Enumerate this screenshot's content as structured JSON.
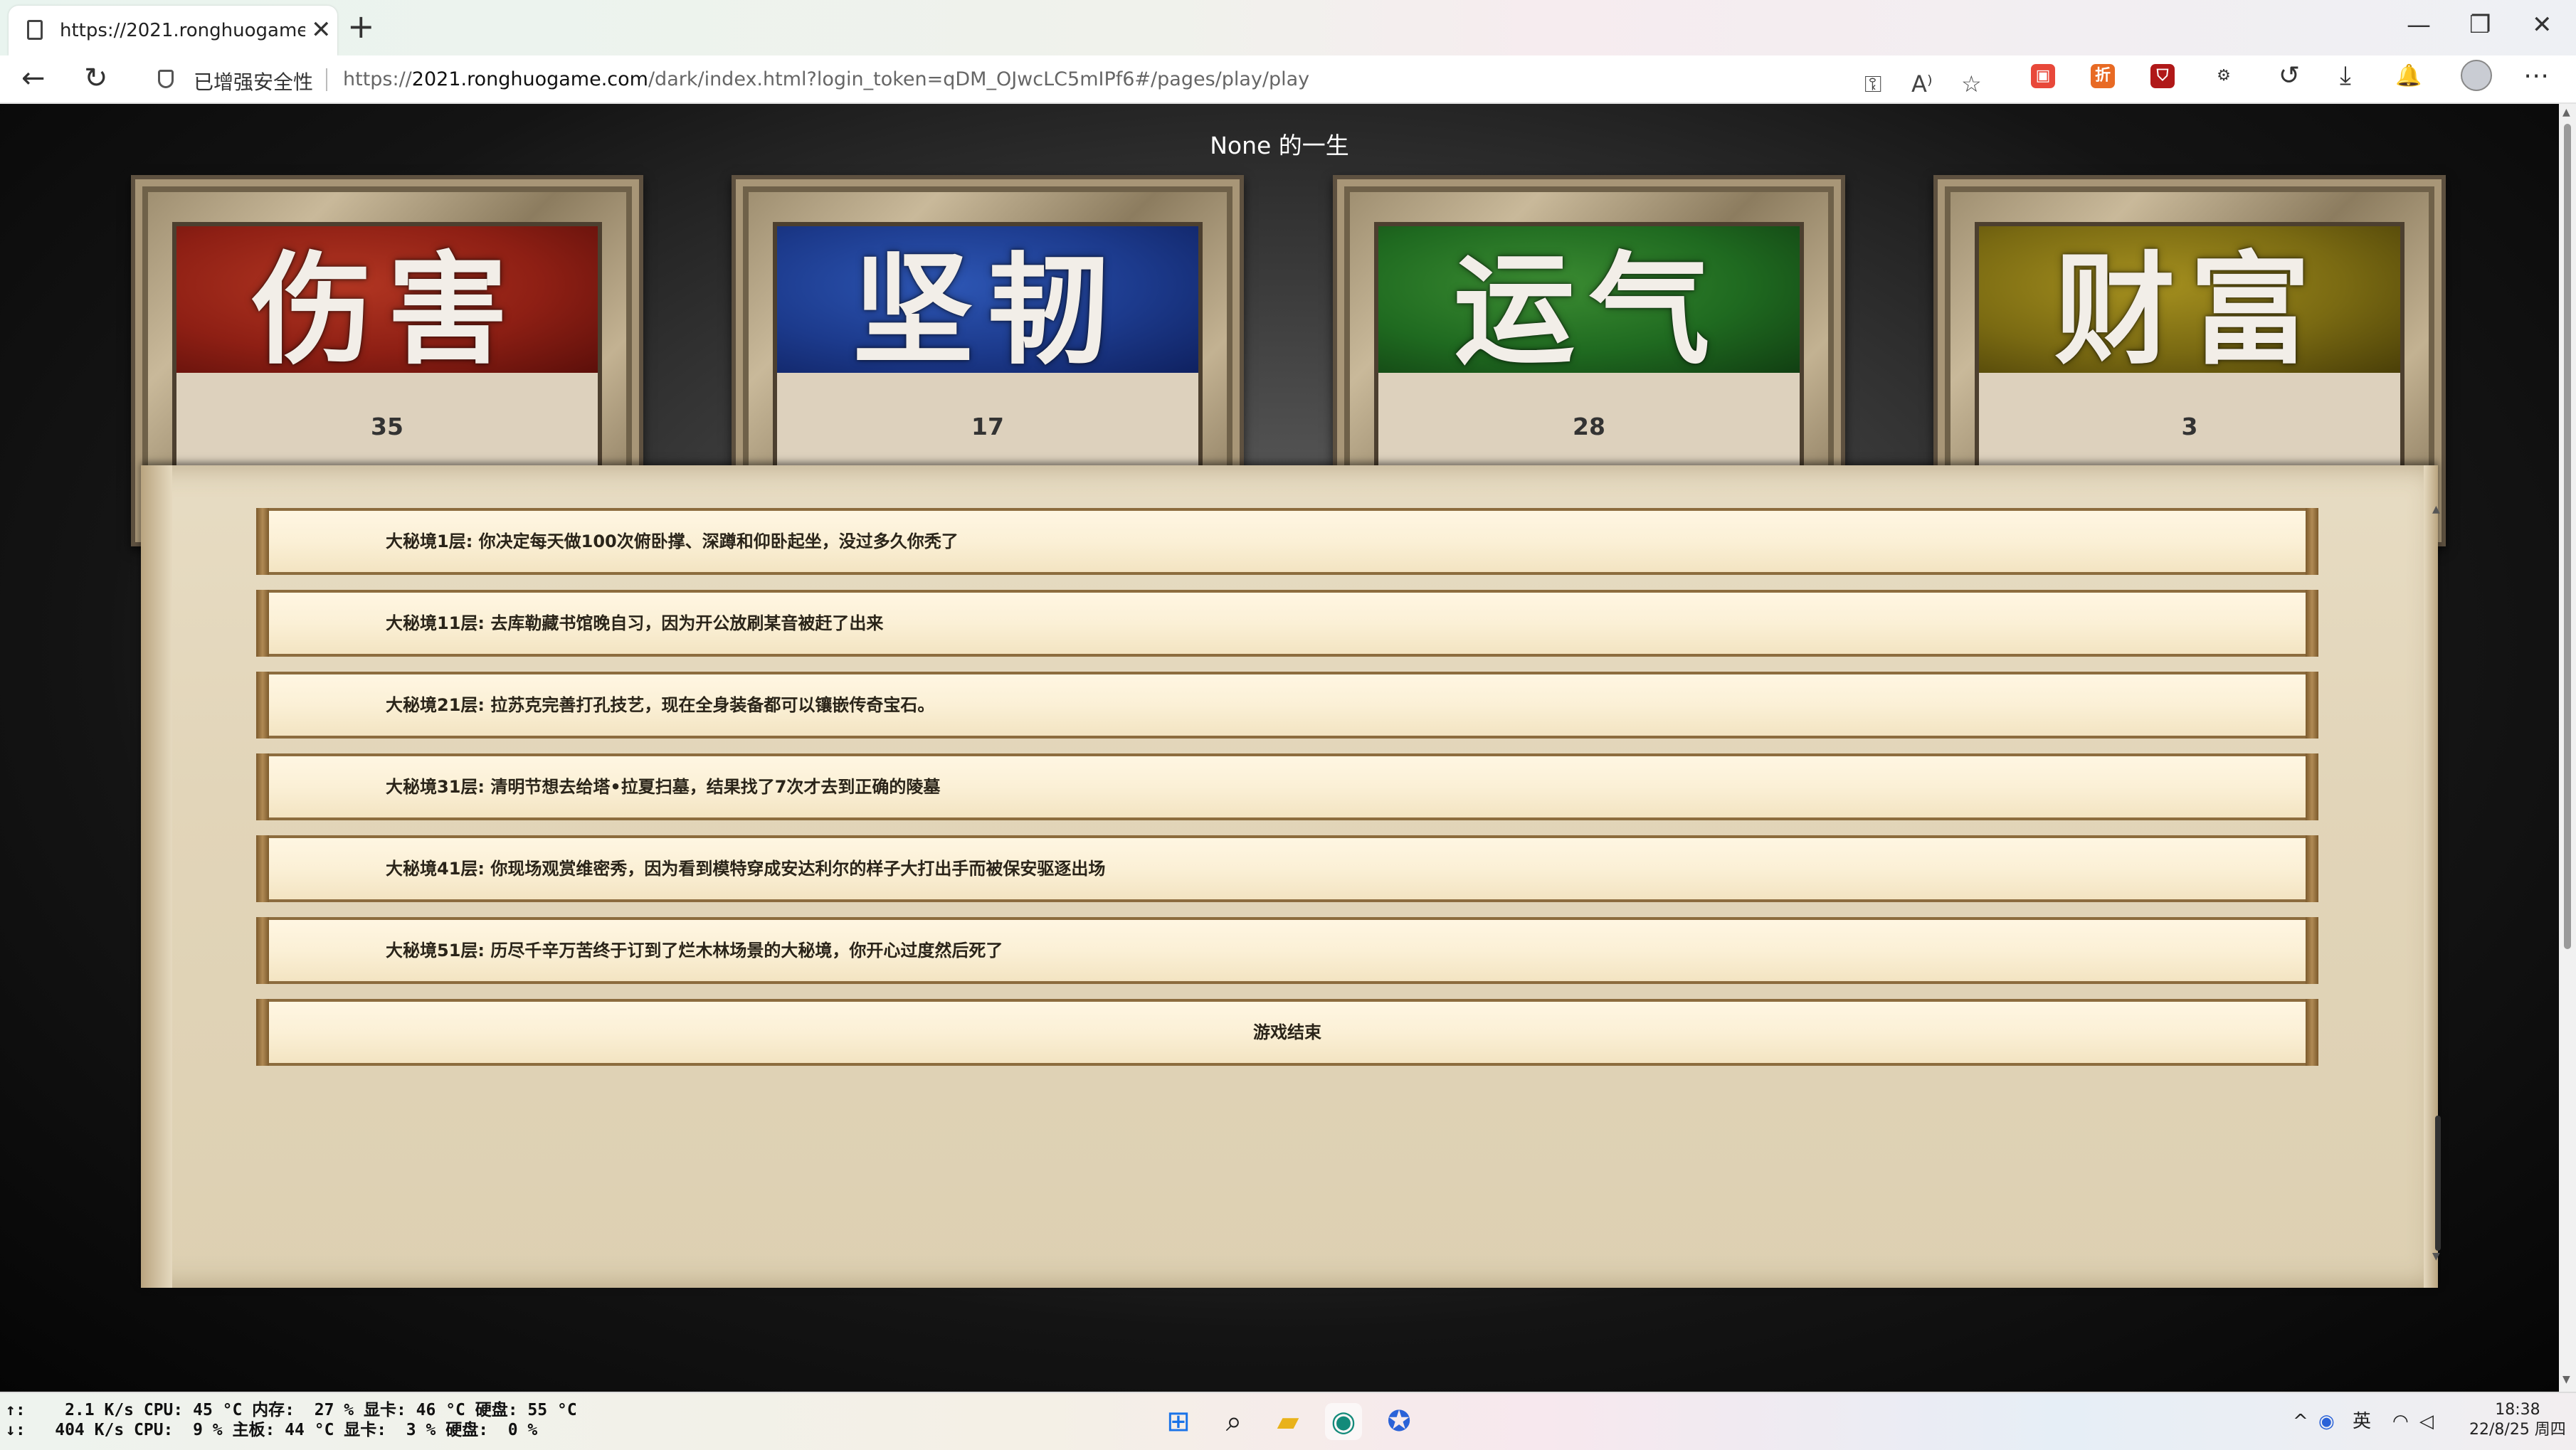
{
  "browser": {
    "tab_title": "https://2021.ronghuogame.com",
    "tab_close": "✕",
    "new_tab": "+",
    "window_controls": [
      "—",
      "❐",
      "✕"
    ],
    "nav": {
      "back": "←",
      "reload": "↻"
    },
    "security_label": "已增强安全性",
    "url_prefix": "https://",
    "url_host": "2021.ronghuogame.com",
    "url_path": "/dark/index.html?login_token=qDM_OJwcLC5mIPf6#/pages/play/play",
    "addr_icons": {
      "key": "⚿",
      "read_aloud": "A⁾",
      "favorite": "☆"
    },
    "extensions": [
      {
        "label": "▣",
        "color": "#e8483a"
      },
      {
        "label": "折",
        "color": "#e86a24"
      },
      {
        "label": "⛉",
        "color": "#b01818"
      },
      {
        "label": "⚙",
        "color": "#555555"
      }
    ],
    "toolbar_icons": {
      "history": "↺",
      "download": "⤓",
      "bell": "🔔",
      "more": "⋯"
    }
  },
  "game": {
    "title": "None 的一生",
    "stats": [
      {
        "name": "伤害",
        "value": "35",
        "color": "red"
      },
      {
        "name": "坚韧",
        "value": "17",
        "color": "blue"
      },
      {
        "name": "运气",
        "value": "28",
        "color": "green"
      },
      {
        "name": "财富",
        "value": "3",
        "color": "gold"
      }
    ],
    "events": [
      "大秘境1层: 你决定每天做100次俯卧撑、深蹲和仰卧起坐，没过多久你秃了",
      "大秘境11层: 去库勒藏书馆晚自习，因为开公放刷某音被赶了出来",
      "大秘境21层: 拉苏克完善打孔技艺，现在全身装备都可以镶嵌传奇宝石。",
      "大秘境31层: 清明节想去给塔•拉夏扫墓，结果找了7次才去到正确的陵墓",
      "大秘境41层: 你现场观赏维密秀，因为看到模特穿成安达利尔的样子大打出手而被保安驱逐出场",
      "大秘境51层: 历尽千辛万苦终于订到了烂木林场景的大秘境，你开心过度然后死了"
    ],
    "end_label": "游戏结束"
  },
  "taskbar": {
    "stats_line1": "↑:    2.1 K/s CPU: 45 °C 内存:  27 % 显卡: 46 °C 硬盘: 55 °C",
    "stats_line2": "↓:   404 K/s CPU:  9 % 主板: 44 °C 显卡:  3 % 硬盘:  0 %",
    "apps": [
      {
        "name": "start",
        "glyph": "⊞",
        "color": "#1a73e8"
      },
      {
        "name": "search",
        "glyph": "⌕",
        "color": "#222"
      },
      {
        "name": "explorer",
        "glyph": "▰",
        "color": "#e9b21a"
      },
      {
        "name": "edge",
        "glyph": "◉",
        "color": "#138a7a"
      },
      {
        "name": "app",
        "glyph": "✪",
        "color": "#2a62d8"
      }
    ],
    "tray": {
      "chevron": "^",
      "ime": "英",
      "wifi": "◠",
      "volume": "◁"
    },
    "time": "18:38",
    "date": "22/8/25 周四"
  }
}
